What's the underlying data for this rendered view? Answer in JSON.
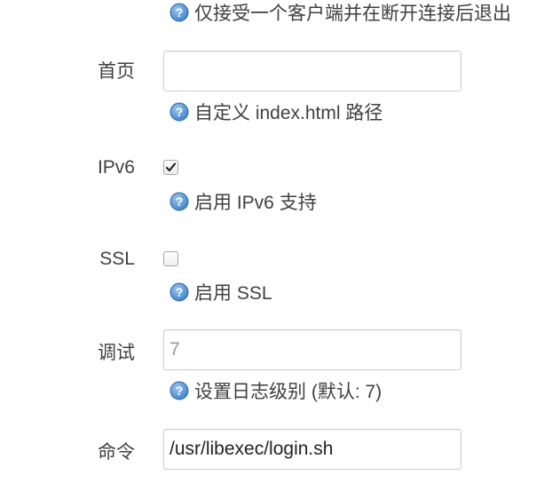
{
  "top_hint": "仅接受一个客户端并在断开连接后退出",
  "homepage": {
    "label": "首页",
    "value": "",
    "hint": "自定义 index.html 路径"
  },
  "ipv6": {
    "label": "IPv6",
    "checked": true,
    "hint": "启用 IPv6 支持"
  },
  "ssl": {
    "label": "SSL",
    "checked": false,
    "hint": "启用 SSL"
  },
  "debug": {
    "label": "调试",
    "placeholder": "7",
    "value": "",
    "hint": "设置日志级别 (默认: 7)"
  },
  "command": {
    "label": "命令",
    "value": "/usr/libexec/login.sh"
  },
  "icons": {
    "help": "question-circle-icon",
    "check": "checkmark-icon"
  },
  "colors": {
    "help_icon": "#4a90d9"
  }
}
